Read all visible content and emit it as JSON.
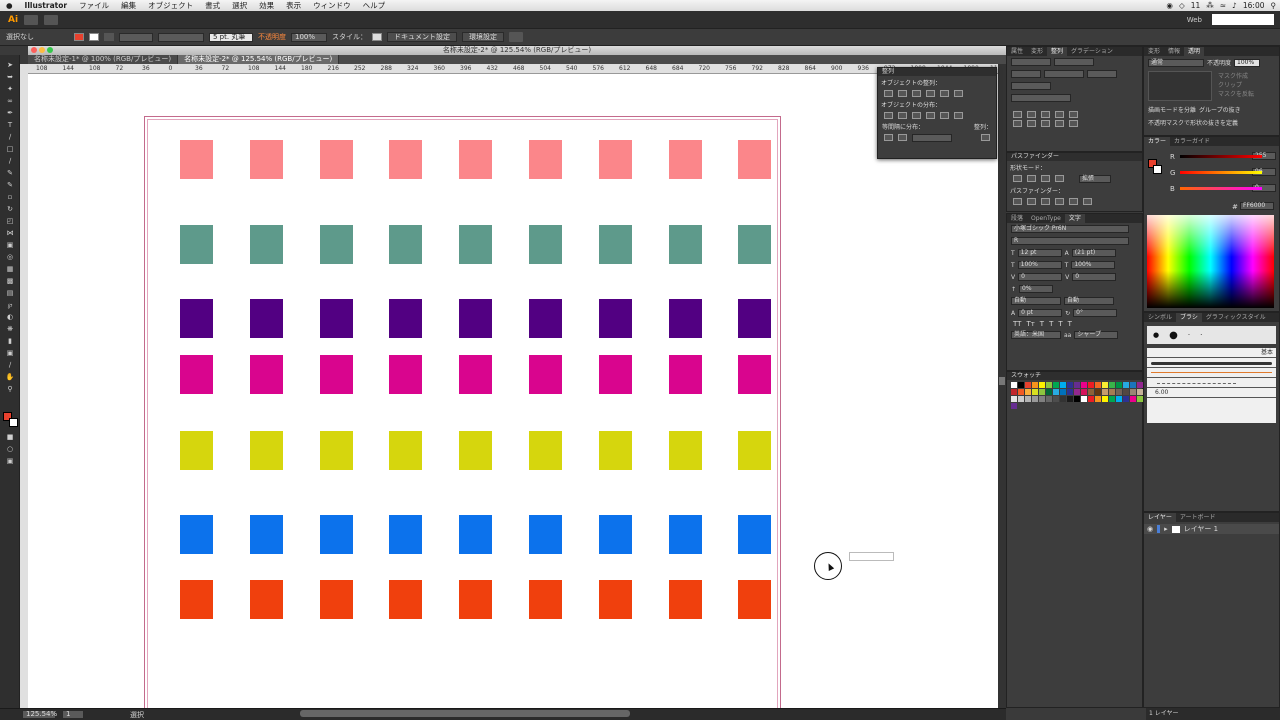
{
  "menubar": {
    "apple": "",
    "app": "Illustrator",
    "items": [
      "ファイル",
      "編集",
      "オブジェクト",
      "書式",
      "選択",
      "効果",
      "表示",
      "ウィンドウ",
      "ヘルプ"
    ],
    "status_num": "11",
    "clock": "16:00"
  },
  "appbar": {
    "logo": "Ai",
    "workspace": "Web"
  },
  "control": {
    "selection": "選択なし",
    "fill_color": "#e8412e",
    "stroke_weight": "5 pt. 丸筆",
    "opacity_label": "不透明度",
    "opacity_value": "100%",
    "style_label": "スタイル：",
    "doc_setup": "ドキュメント設定",
    "prefs": "環境設定"
  },
  "document": {
    "title": "名称未設定-2* @ 125.54% (RGB/プレビュー)",
    "tabs": [
      {
        "label": "名称未設定-1* @ 100% (RGB/プレビュー)",
        "active": false
      },
      {
        "label": "名称未設定-2* @ 125.54% (RGB/プレビュー)",
        "active": true
      }
    ],
    "ruler": [
      "108",
      "144",
      "108",
      "72",
      "36",
      "0",
      "36",
      "72",
      "108",
      "144",
      "180",
      "216",
      "252",
      "288",
      "324",
      "360",
      "396",
      "432",
      "468",
      "504",
      "540",
      "576",
      "612",
      "648",
      "684",
      "720",
      "756",
      "792",
      "828",
      "864",
      "900",
      "936",
      "972",
      "1008",
      "1044",
      "1080",
      "1116"
    ]
  },
  "artwork": {
    "rows": [
      {
        "color": "#fb868a",
        "count": 9
      },
      {
        "color": "#5e9a8b",
        "count": 9
      },
      {
        "color": "#520082",
        "count": 9
      },
      {
        "color": "#d9058e",
        "count": 9
      },
      {
        "color": "#d6d60d",
        "count": 9
      },
      {
        "color": "#0c72ec",
        "count": 9
      },
      {
        "color": "#f0400d",
        "count": 9
      }
    ]
  },
  "status": {
    "zoom": "125.54%",
    "page": "1",
    "tool": "選択"
  },
  "align_panel": {
    "title": "整列",
    "align_objects": "オブジェクトの整列：",
    "distribute_objects": "オブジェクトの分布：",
    "spacing": "等間隔に分布：",
    "align_to": "整列："
  },
  "panels": {
    "transform_tabs": [
      "属性",
      "変形",
      "整列",
      "グラデーション"
    ],
    "pathfinder_title": "パスファインダー",
    "shape_modes": "形状モード：",
    "pathfinders": "パスファインダー：",
    "expand": "拡張",
    "char_tabs": [
      "段落",
      "OpenType",
      "文字"
    ],
    "font_name": "小塚ゴシック Pr6N",
    "font_style": "R",
    "font_size": "12 pt",
    "leading": "(21 pt)",
    "scale_v": "100%",
    "scale_h": "100%",
    "tracking": "0",
    "kerning": "0",
    "tsume": "0%",
    "auto1": "自動",
    "auto2": "自動",
    "baseline": "0 pt",
    "rotate": "0°",
    "lang": "英語：米国",
    "aa": "シャープ",
    "swatches_title": "スウォッチ",
    "appearance_tabs": [
      "変形",
      "情報",
      "透明"
    ],
    "blend": "通常",
    "opacity": "100%",
    "mask_make": "マスク作成",
    "clip": "クリップ",
    "invert": "マスクを反転",
    "isolate": "描画モードを分離",
    "knockout": "グループの抜き",
    "opacity_mask": "不透明マスクで形状の抜きを定義",
    "color_tabs": [
      "カラー",
      "カラーガイド"
    ],
    "r_value": "255",
    "g_value": "96",
    "b_value": "0",
    "hex": "FF6000",
    "brush_tabs": [
      "シンボル",
      "ブラシ",
      "グラフィックスタイル"
    ],
    "brush_basic": "基本",
    "brush_size": "6.00",
    "layers_tabs": [
      "レイヤー",
      "アートボード"
    ],
    "layer_name": "レイヤー 1",
    "layer_count": "1 レイヤー"
  }
}
